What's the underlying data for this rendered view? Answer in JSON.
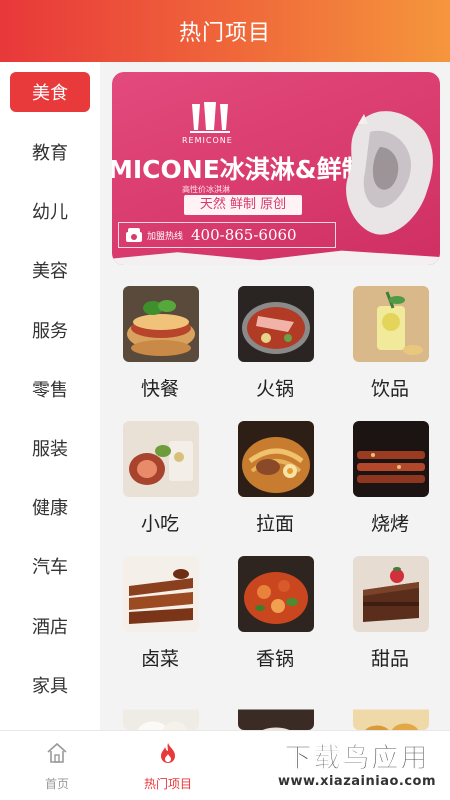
{
  "header": {
    "title": "热门项目"
  },
  "sidebar": {
    "items": [
      {
        "label": "美食",
        "active": true
      },
      {
        "label": "教育"
      },
      {
        "label": "幼儿"
      },
      {
        "label": "美容"
      },
      {
        "label": "服务"
      },
      {
        "label": "零售"
      },
      {
        "label": "服装"
      },
      {
        "label": "健康"
      },
      {
        "label": "汽车"
      },
      {
        "label": "酒店"
      },
      {
        "label": "家具"
      }
    ]
  },
  "banner": {
    "brand": "REMICONE",
    "headline": "MICONE冰淇淋&鲜制茶",
    "subtitle": "高性价冰淇淋",
    "slogan": "天然 鲜制 原创",
    "hotline_label": "加盟热线",
    "hotline_number": "400-865-6060"
  },
  "categories": [
    {
      "label": "快餐",
      "icon": "sandwich-photo"
    },
    {
      "label": "火锅",
      "icon": "hotpot-photo"
    },
    {
      "label": "饮品",
      "icon": "drink-photo"
    },
    {
      "label": "小吃",
      "icon": "snack-photo"
    },
    {
      "label": "拉面",
      "icon": "ramen-photo"
    },
    {
      "label": "烧烤",
      "icon": "bbq-photo"
    },
    {
      "label": "卤菜",
      "icon": "braised-duck-photo"
    },
    {
      "label": "香锅",
      "icon": "spicy-pot-photo"
    },
    {
      "label": "甜品",
      "icon": "cake-photo"
    }
  ],
  "tabbar": {
    "items": [
      {
        "label": "首页",
        "icon": "home-icon",
        "active": false
      },
      {
        "label": "热门项目",
        "icon": "fire-icon",
        "active": true
      }
    ]
  },
  "watermark": {
    "main": "下载鸟应用",
    "sub": "www.xiazainiao.com"
  },
  "colors": {
    "accent": "#e8393b",
    "header_start": "#e8383a",
    "header_end": "#f5963c",
    "banner_bg": "#d83a6d"
  }
}
